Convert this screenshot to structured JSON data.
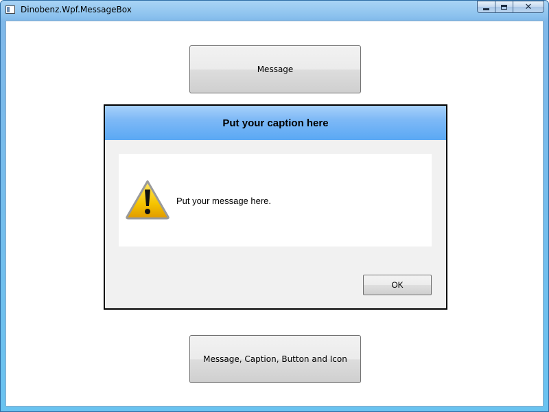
{
  "window": {
    "title": "Dinobenz.Wpf.MessageBox",
    "icon": "window-app-icon",
    "controls": {
      "minimize": "minimize-icon",
      "maximize": "maximize-icon",
      "close_label": "✕"
    }
  },
  "main": {
    "message_button_label": "Message",
    "full_button_label": "Message, Caption, Button and Icon"
  },
  "dialog": {
    "caption": "Put your caption here",
    "message": "Put your message here.",
    "icon": "warning-icon",
    "ok_label": "OK"
  },
  "colors": {
    "dialog_header": "#5aa8f4",
    "dialog_background": "#f1f1f1",
    "warning_yellow": "#f5c400"
  }
}
